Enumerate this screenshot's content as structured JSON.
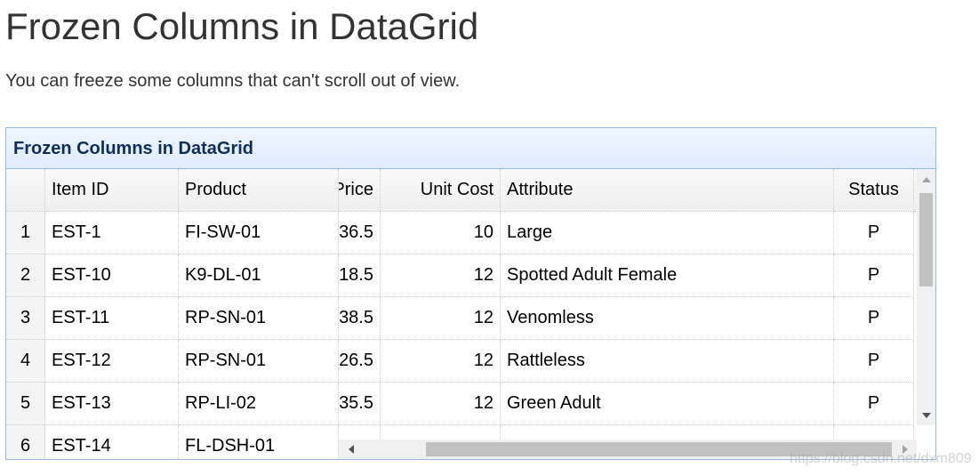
{
  "page": {
    "title": "Frozen Columns in DataGrid",
    "description": "You can freeze some columns that can't scroll out of view."
  },
  "grid": {
    "title": "Frozen Columns in DataGrid",
    "frozen_columns": [
      "Item ID",
      "Product"
    ],
    "scroll_columns": [
      "Price",
      "Unit Cost",
      "Attribute",
      "Status"
    ],
    "rows": [
      {
        "num": "1",
        "item_id": "EST-1",
        "product": "FI-SW-01",
        "price": "36.5",
        "unit_cost": "10",
        "attribute": "Large",
        "status": "P"
      },
      {
        "num": "2",
        "item_id": "EST-10",
        "product": "K9-DL-01",
        "price": "18.5",
        "unit_cost": "12",
        "attribute": "Spotted Adult Female",
        "status": "P"
      },
      {
        "num": "3",
        "item_id": "EST-11",
        "product": "RP-SN-01",
        "price": "38.5",
        "unit_cost": "12",
        "attribute": "Venomless",
        "status": "P"
      },
      {
        "num": "4",
        "item_id": "EST-12",
        "product": "RP-SN-01",
        "price": "26.5",
        "unit_cost": "12",
        "attribute": "Rattleless",
        "status": "P"
      },
      {
        "num": "5",
        "item_id": "EST-13",
        "product": "RP-LI-02",
        "price": "35.5",
        "unit_cost": "12",
        "attribute": "Green Adult",
        "status": "P"
      },
      {
        "num": "6",
        "item_id": "EST-14",
        "product": "FL-DSH-01",
        "price": "",
        "unit_cost": "",
        "attribute": "",
        "status": ""
      }
    ]
  },
  "watermark": "https://blog.csdn.net/dxm809",
  "colors": {
    "header_text": "#0e2d5f",
    "panel_border": "#95b8e7",
    "header_bg": "#e0ecff"
  },
  "icons": {
    "scroll_up": "triangle-up-icon",
    "scroll_down": "triangle-down-icon",
    "scroll_left": "triangle-left-icon",
    "scroll_right": "triangle-right-icon"
  }
}
